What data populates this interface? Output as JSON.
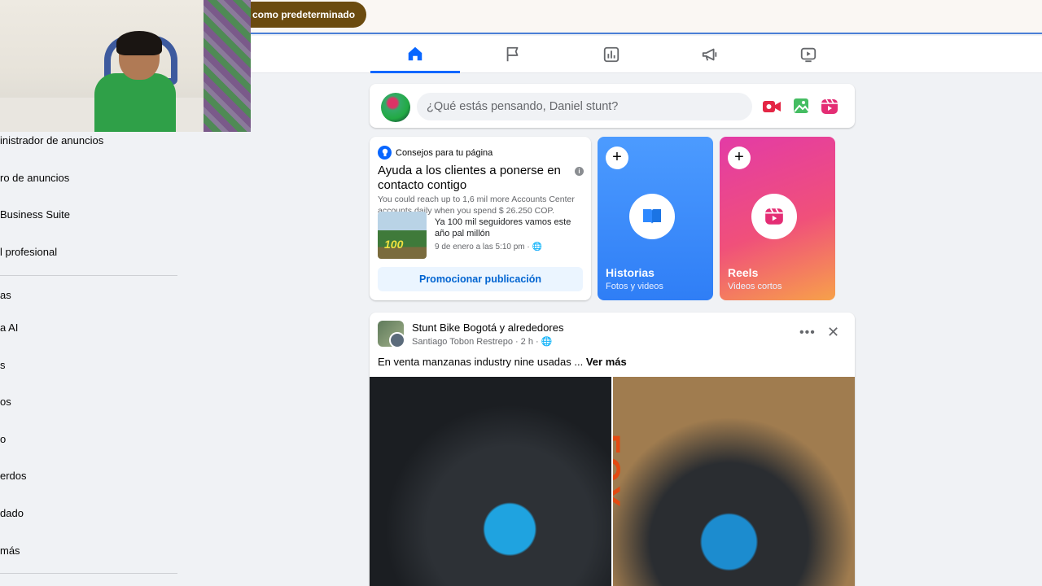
{
  "banner": {
    "default_pill": "como predeterminado"
  },
  "nav": {
    "tabs": [
      {
        "name": "home",
        "active": true
      },
      {
        "name": "pages"
      },
      {
        "name": "insights"
      },
      {
        "name": "ads"
      },
      {
        "name": "watch"
      }
    ],
    "accent": "#0866ff"
  },
  "sidebar": {
    "items": [
      "inistrador de anuncios",
      "ro de anuncios",
      "Business Suite",
      "l profesional",
      "as",
      "a AI",
      "s",
      "os",
      "o",
      "erdos",
      "dado",
      "más"
    ]
  },
  "composer": {
    "placeholder": "¿Qué estás pensando, Daniel stunt?"
  },
  "tips": {
    "header": "Consejos para tu página",
    "title": "Ayuda a los clientes a ponerse en contacto contigo",
    "body": "You could reach up to 1,6 mil more Accounts Center accounts daily when you spend $ 26.250 COP.",
    "post_text": "Ya 100 mil seguidores vamos este año pal millón",
    "post_date": "9 de enero a las 5:10 pm ·",
    "thumb_label": "100",
    "button": "Promocionar publicación"
  },
  "stories": [
    {
      "title": "Historias",
      "subtitle": "Fotos y videos"
    },
    {
      "title": "Reels",
      "subtitle": "Videos cortos"
    }
  ],
  "feed_post": {
    "group": "Stunt Bike Bogotá y alrededores",
    "author": "Santiago Tobon Restrepo",
    "time": "· 2 h ·",
    "text": "En venta manzanas industry nine usadas ...",
    "see_more": "Ver más",
    "photo_text": "FOX"
  }
}
